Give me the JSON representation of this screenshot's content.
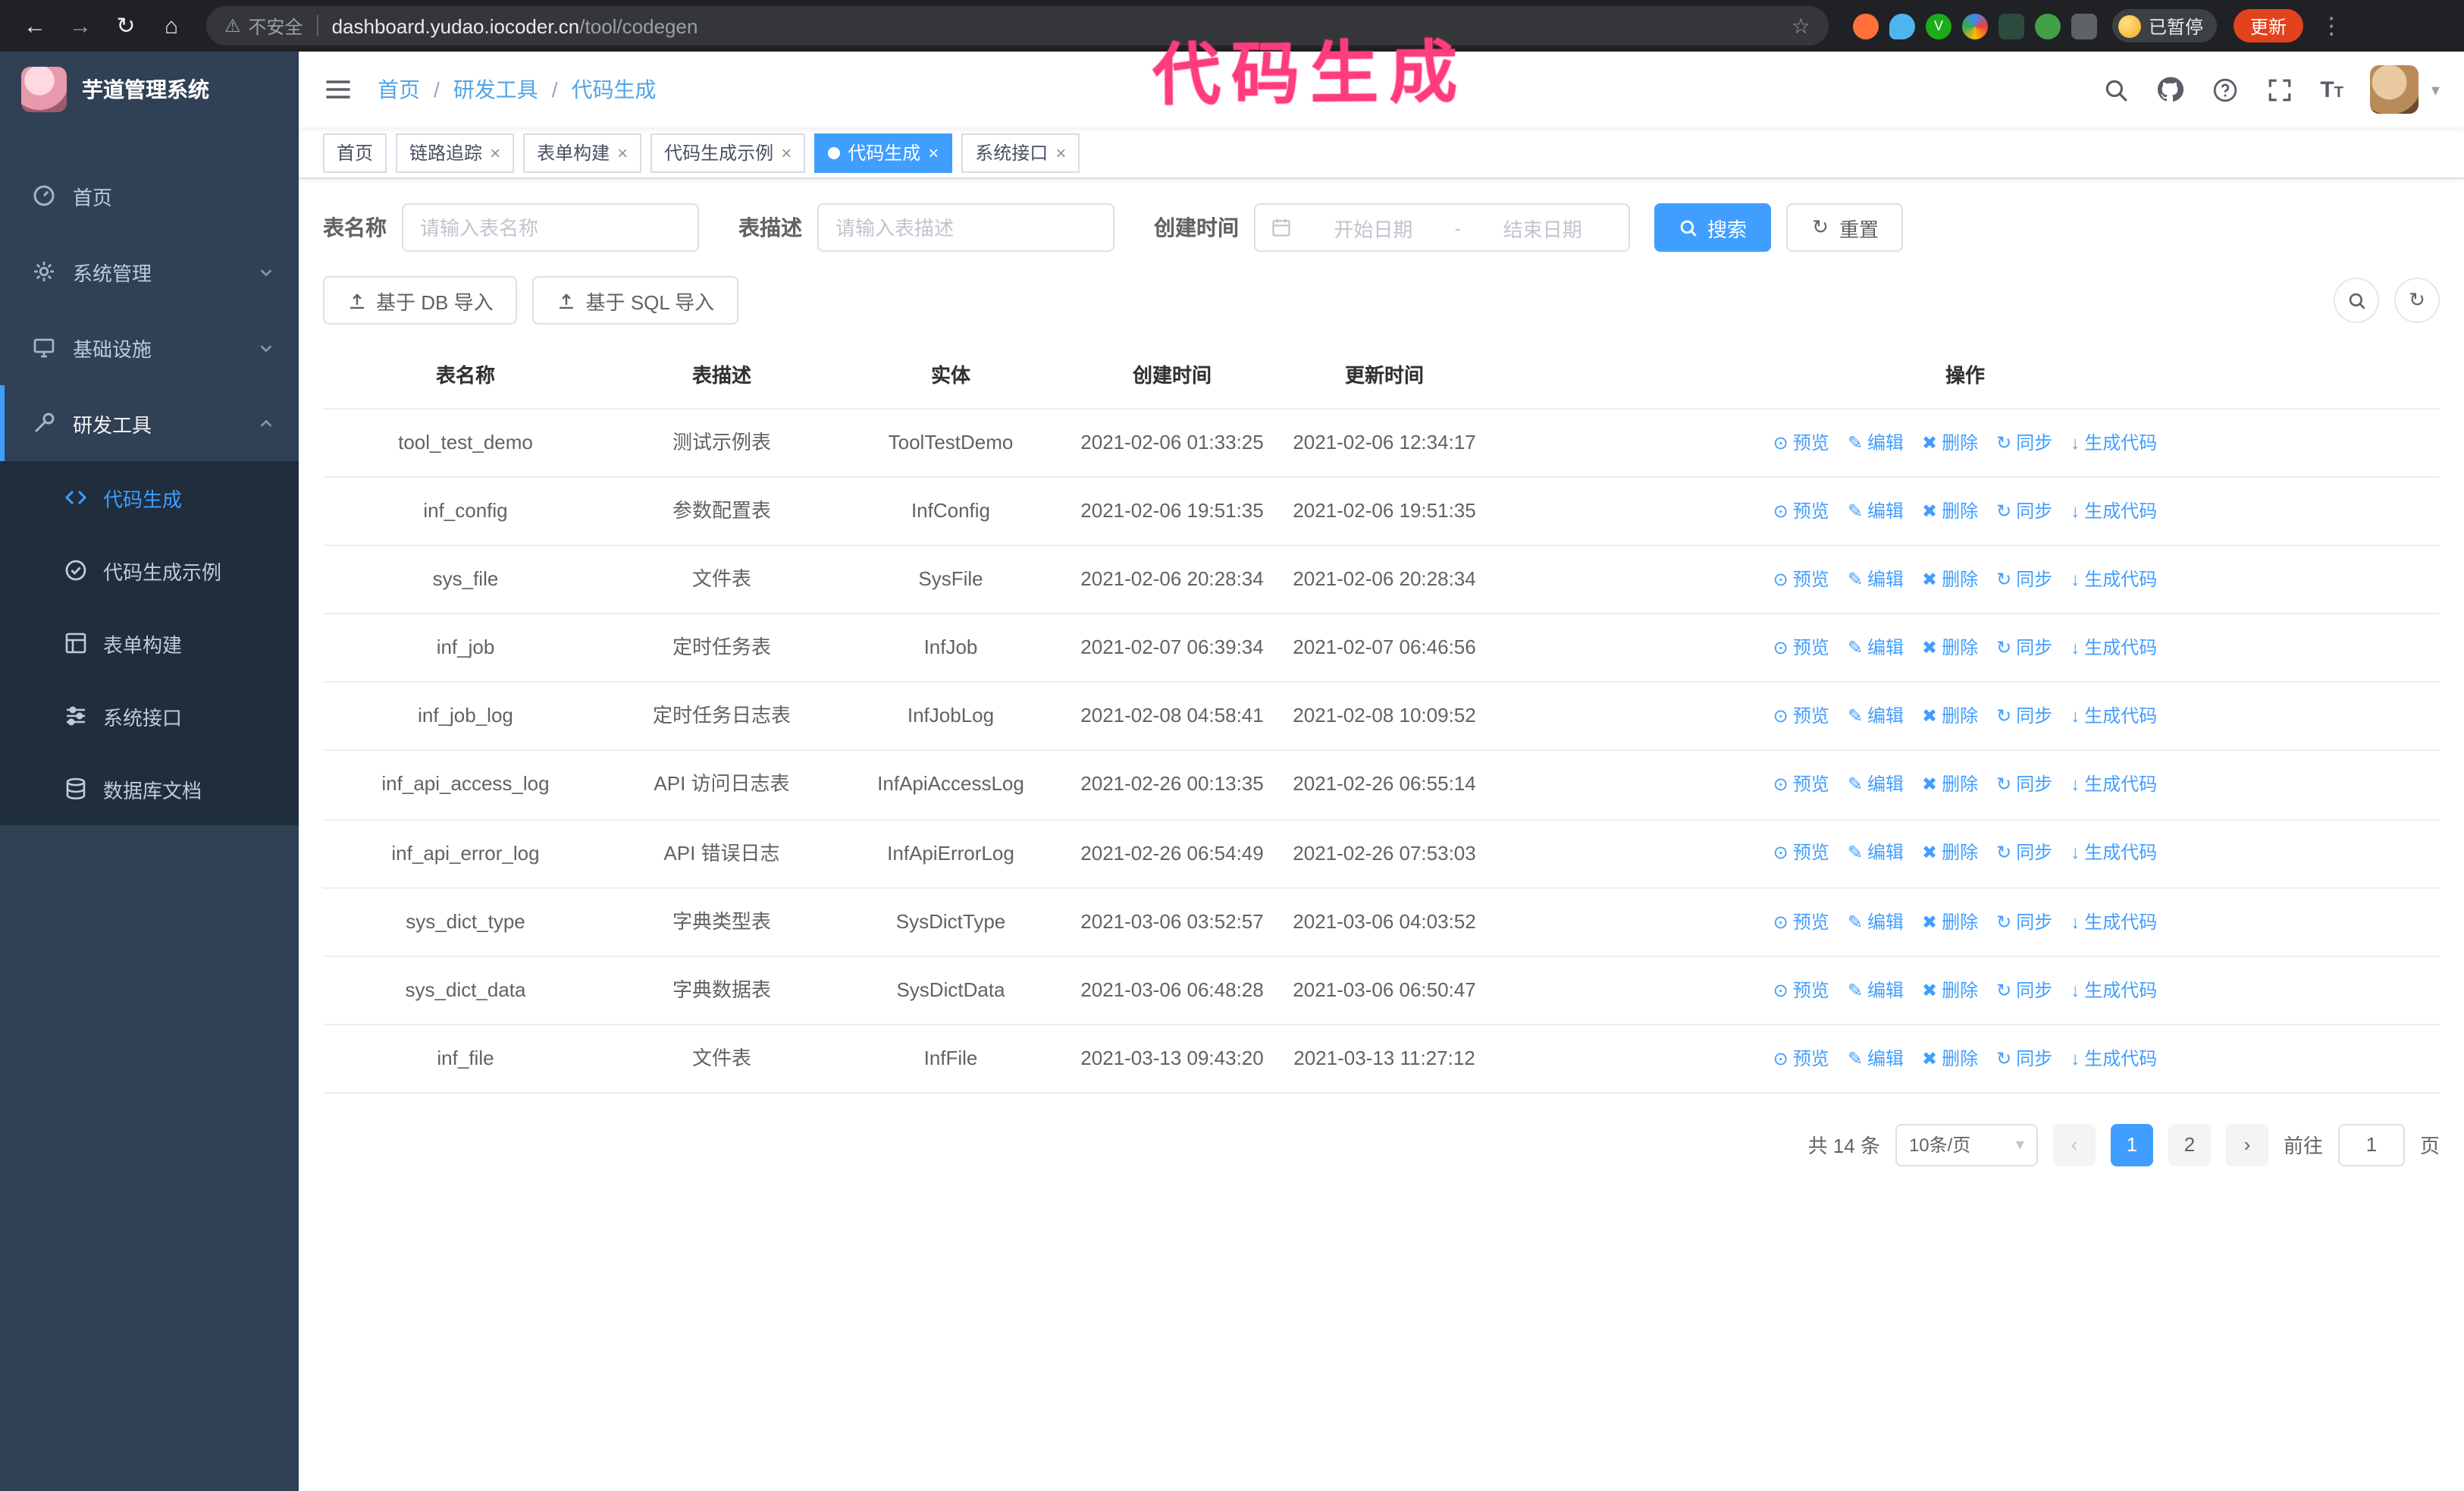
{
  "annotation": {
    "text": "代码生成"
  },
  "browser": {
    "security_label": "不安全",
    "url_host": "dashboard.yudao.iocoder.cn",
    "url_path": "/tool/codegen",
    "paused_badge": "已暂停",
    "update_button": "更新"
  },
  "sidebar": {
    "logo_title": "芋道管理系统",
    "items": [
      {
        "label": "首页"
      },
      {
        "label": "系统管理"
      },
      {
        "label": "基础设施"
      },
      {
        "label": "研发工具"
      }
    ],
    "subitems": [
      {
        "label": "代码生成"
      },
      {
        "label": "代码生成示例"
      },
      {
        "label": "表单构建"
      },
      {
        "label": "系统接口"
      },
      {
        "label": "数据库文档"
      }
    ]
  },
  "breadcrumb": {
    "items": [
      "首页",
      "研发工具",
      "代码生成"
    ]
  },
  "tags": [
    {
      "label": "首页"
    },
    {
      "label": "链路追踪"
    },
    {
      "label": "表单构建"
    },
    {
      "label": "代码生成示例"
    },
    {
      "label": "代码生成"
    },
    {
      "label": "系统接口"
    }
  ],
  "filters": {
    "table_name_label": "表名称",
    "table_name_placeholder": "请输入表名称",
    "table_desc_label": "表描述",
    "table_desc_placeholder": "请输入表描述",
    "create_time_label": "创建时间",
    "date_start_placeholder": "开始日期",
    "date_separator": "-",
    "date_end_placeholder": "结束日期",
    "search_button": "搜索",
    "reset_button": "重置"
  },
  "toolbar": {
    "import_db": "基于 DB 导入",
    "import_sql": "基于 SQL 导入"
  },
  "table": {
    "columns": [
      "表名称",
      "表描述",
      "实体",
      "创建时间",
      "更新时间",
      "操作"
    ],
    "actions": [
      "预览",
      "编辑",
      "删除",
      "同步",
      "生成代码"
    ],
    "rows": [
      [
        "tool_test_demo",
        "测试示例表",
        "ToolTestDemo",
        "2021-02-06 01:33:25",
        "2021-02-06 12:34:17"
      ],
      [
        "inf_config",
        "参数配置表",
        "InfConfig",
        "2021-02-06 19:51:35",
        "2021-02-06 19:51:35"
      ],
      [
        "sys_file",
        "文件表",
        "SysFile",
        "2021-02-06 20:28:34",
        "2021-02-06 20:28:34"
      ],
      [
        "inf_job",
        "定时任务表",
        "InfJob",
        "2021-02-07 06:39:34",
        "2021-02-07 06:46:56"
      ],
      [
        "inf_job_log",
        "定时任务日志表",
        "InfJobLog",
        "2021-02-08 04:58:41",
        "2021-02-08 10:09:52"
      ],
      [
        "inf_api_access_log",
        "API 访问日志表",
        "InfApiAccessLog",
        "2021-02-26 00:13:35",
        "2021-02-26 06:55:14"
      ],
      [
        "inf_api_error_log",
        "API 错误日志",
        "InfApiErrorLog",
        "2021-02-26 06:54:49",
        "2021-02-26 07:53:03"
      ],
      [
        "sys_dict_type",
        "字典类型表",
        "SysDictType",
        "2021-03-06 03:52:57",
        "2021-03-06 04:03:52"
      ],
      [
        "sys_dict_data",
        "字典数据表",
        "SysDictData",
        "2021-03-06 06:48:28",
        "2021-03-06 06:50:47"
      ],
      [
        "inf_file",
        "文件表",
        "InfFile",
        "2021-03-13 09:43:20",
        "2021-03-13 11:27:12"
      ]
    ]
  },
  "pagination": {
    "total": "共 14 条",
    "page_size": "10条/页",
    "pages": [
      "1",
      "2"
    ],
    "goto_label": "前往",
    "goto_value": "1",
    "goto_suffix": "页"
  },
  "icons": {
    "back": "←",
    "forward": "→",
    "reload": "↻",
    "home": "⌂",
    "warning": "⚠",
    "star": "☆",
    "kebab": "⋮",
    "close": "×",
    "caret": "▾",
    "eye": "⊙",
    "edit": "✎",
    "delete": "✖",
    "sync": "↻",
    "generate": "↓",
    "upload": "↥",
    "refresh": "↻",
    "prev": "‹",
    "next": "›",
    "separator": "/"
  }
}
